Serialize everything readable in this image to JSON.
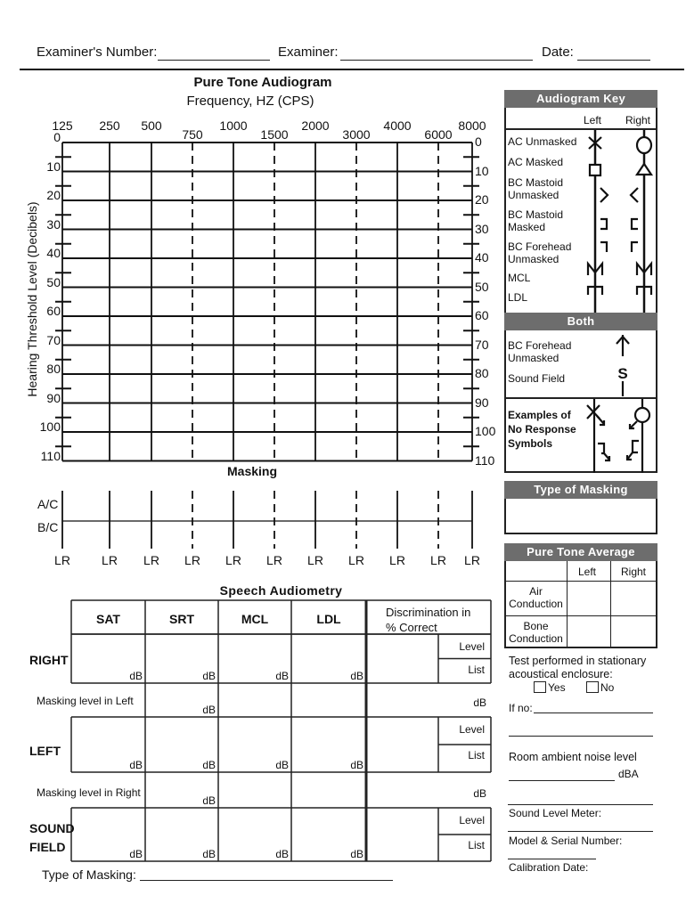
{
  "header": {
    "examiner_number_label": "Examiner's Number:",
    "examiner_number_value": "",
    "examiner_label": "Examiner:",
    "examiner_value": "",
    "date_label": "Date:",
    "date_value": ""
  },
  "audiogram": {
    "title": "Pure Tone Audiogram",
    "subtitle": "Frequency, HZ (CPS)",
    "y_axis_label": "Hearing Threshold Level (Decibels)",
    "frequencies_top": [
      "125",
      "250",
      "500",
      "1000",
      "2000",
      "4000",
      "8000"
    ],
    "frequencies_mid": [
      "750",
      "1500",
      "3000",
      "6000"
    ],
    "db_levels": [
      "0",
      "10",
      "20",
      "30",
      "40",
      "50",
      "60",
      "70",
      "80",
      "90",
      "100",
      "110"
    ]
  },
  "masking": {
    "title": "Masking",
    "row_labels": [
      "A/C",
      "B/C"
    ],
    "column_label": "LR"
  },
  "audiogram_key": {
    "title": "Audiogram Key",
    "col_left": "Left",
    "col_right": "Right",
    "rows": [
      {
        "label": "AC Unmasked",
        "left_icon": "x-symbol-icon",
        "right_icon": "circle-symbol-icon"
      },
      {
        "label": "AC Masked",
        "left_icon": "square-symbol-icon",
        "right_icon": "triangle-symbol-icon"
      },
      {
        "label": "BC  Mastoid Unmasked",
        "left_icon": "greater-than-symbol-icon",
        "right_icon": "less-than-symbol-icon"
      },
      {
        "label": "BC  Mastoid Masked",
        "left_icon": "right-bracket-symbol-icon",
        "right_icon": "left-bracket-symbol-icon"
      },
      {
        "label": "BC  Forehead Unmasked",
        "left_icon": "right-corner-symbol-icon",
        "right_icon": "left-corner-symbol-icon"
      },
      {
        "label": "MCL",
        "left_icon": "m-symbol-icon",
        "right_icon": "m-symbol-icon"
      },
      {
        "label": "LDL",
        "left_icon": "u-inverted-symbol-icon",
        "right_icon": "u-inverted-symbol-icon"
      }
    ],
    "both_title": "Both",
    "both_rows": [
      {
        "label": "BC  Forehead Unmasked",
        "icon": "up-arrow-symbol-icon"
      },
      {
        "label": "Sound Field",
        "icon": "s-symbol-icon"
      }
    ],
    "no_response_label": "Examples of No Response Symbols"
  },
  "type_of_masking_panel": {
    "title": "Type of Masking",
    "value": ""
  },
  "pure_tone_average": {
    "title": "Pure Tone Average",
    "columns": [
      "",
      "Left",
      "Right"
    ],
    "rows": [
      {
        "label": "Air Conduction",
        "left": "",
        "right": ""
      },
      {
        "label": "Bone Conduction",
        "left": "",
        "right": ""
      }
    ]
  },
  "enclosure": {
    "question": "Test performed in stationary acoustical enclosure:",
    "yes_label": "Yes",
    "no_label": "No",
    "yes_checked": false,
    "no_checked": false,
    "if_no_label": "If no:",
    "if_no_value": "",
    "noise_label": "Room ambient noise level",
    "noise_unit": "dBA",
    "noise_value": "",
    "sound_level_meter_label": "Sound Level Meter:",
    "model_serial_label": "Model & Serial Number:",
    "calibration_date_label": "Calibration Date:"
  },
  "speech": {
    "title": "Speech Audiometry",
    "columns": [
      "SAT",
      "SRT",
      "MCL",
      "LDL"
    ],
    "discrimination_header": "Discrimination in % Correct",
    "unit": "dB",
    "level_label": "Level",
    "list_label": "List",
    "rows": [
      {
        "label": "RIGHT",
        "type": "ear"
      },
      {
        "label": "Masking level in Left",
        "type": "masking"
      },
      {
        "label": "LEFT",
        "type": "ear"
      },
      {
        "label": "Masking level in Right",
        "type": "masking"
      },
      {
        "label": "SOUND FIELD",
        "type": "ear"
      }
    ],
    "type_of_masking_label": "Type of Masking:",
    "type_of_masking_value": ""
  }
}
